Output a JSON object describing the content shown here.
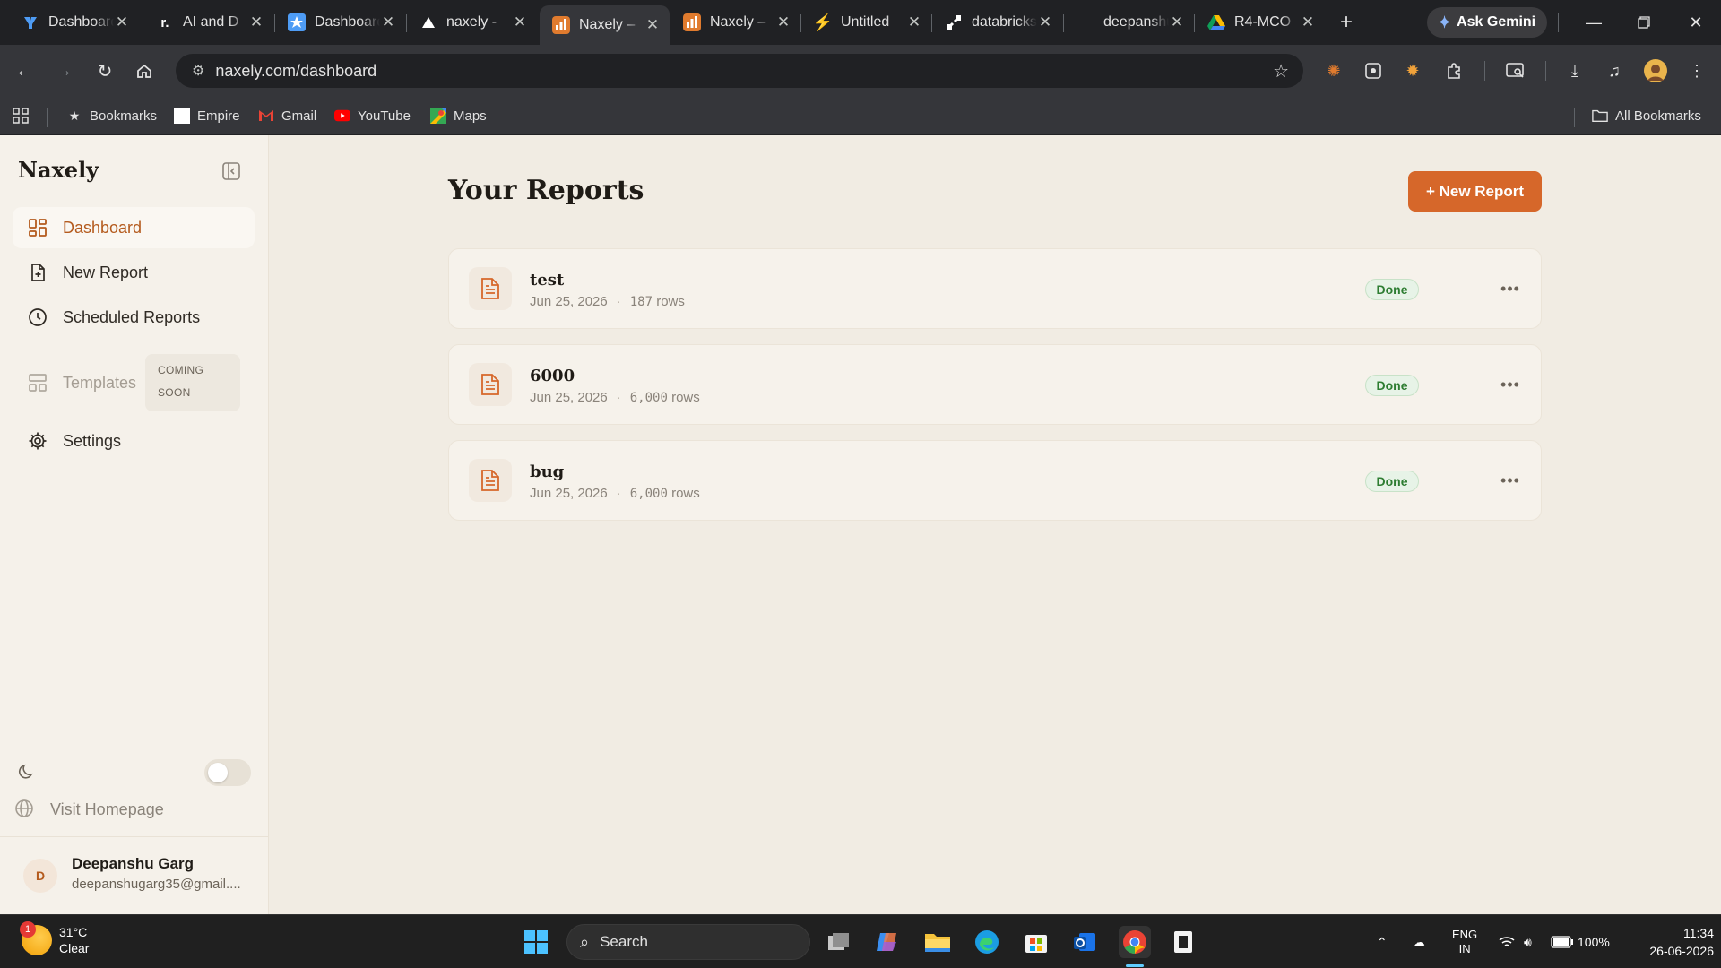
{
  "browser": {
    "tabs": [
      {
        "title": "Dashboard",
        "icon": "y-logo-icon"
      },
      {
        "title": "AI and D",
        "icon": "r-logo-icon"
      },
      {
        "title": "Dashboard",
        "icon": "star-logo-icon"
      },
      {
        "title": "naxely -",
        "icon": "vercel-triangle-icon"
      },
      {
        "title": "Naxely –",
        "icon": "naxely-chart-icon",
        "active": true
      },
      {
        "title": "Naxely –",
        "icon": "naxely-chart-icon"
      },
      {
        "title": "Untitled",
        "icon": "bolt-icon"
      },
      {
        "title": "databricks",
        "icon": "link-icon"
      },
      {
        "title": "deepanshu",
        "icon": "blank-icon"
      },
      {
        "title": "R4-MCO",
        "icon": "drive-icon"
      }
    ],
    "ask_gemini": "Ask Gemini",
    "url": "naxely.com/dashboard",
    "bookmarks": [
      {
        "label": "Bookmarks",
        "icon": "star-icon"
      },
      {
        "label": "Empire",
        "icon": "page-icon"
      },
      {
        "label": "Gmail",
        "icon": "gmail-icon"
      },
      {
        "label": "YouTube",
        "icon": "youtube-icon"
      },
      {
        "label": "Maps",
        "icon": "maps-icon"
      }
    ],
    "all_bookmarks": "All Bookmarks"
  },
  "sidebar": {
    "brand": "Naxely",
    "items": [
      {
        "label": "Dashboard",
        "icon": "dashboard-grid-icon",
        "active": true
      },
      {
        "label": "New Report",
        "icon": "file-plus-icon"
      },
      {
        "label": "Scheduled Reports",
        "icon": "clock-icon"
      },
      {
        "label": "Templates",
        "icon": "templates-icon",
        "disabled": true
      },
      {
        "label": "Settings",
        "icon": "gear-icon"
      }
    ],
    "coming_soon_line1": "COMING",
    "coming_soon_line2": "SOON",
    "visit_homepage": "Visit Homepage",
    "user": {
      "initial": "D",
      "name": "Deepanshu Garg",
      "email": "deepanshugarg35@gmail...."
    }
  },
  "main": {
    "title": "Your Reports",
    "new_report_button": "+ New Report",
    "reports": [
      {
        "name": "test",
        "date": "Jun 25, 2026",
        "rows": "187",
        "rows_label": "rows",
        "status": "Done"
      },
      {
        "name": "6000",
        "date": "Jun 25, 2026",
        "rows": "6,000",
        "rows_label": "rows",
        "status": "Done"
      },
      {
        "name": "bug",
        "date": "Jun 25, 2026",
        "rows": "6,000",
        "rows_label": "rows",
        "status": "Done"
      }
    ]
  },
  "taskbar": {
    "weather_temp": "31°C",
    "weather_desc": "Clear",
    "weather_badge": "1",
    "search_label": "Search",
    "lang_line1": "ENG",
    "lang_line2": "IN",
    "battery": "100%",
    "time": "11:34",
    "date": "26-06-2026"
  },
  "colors": {
    "accent": "#d6672a",
    "active_nav_text": "#b45a1d",
    "status_done": "#2e7d32",
    "app_background": "#f1ece3"
  }
}
